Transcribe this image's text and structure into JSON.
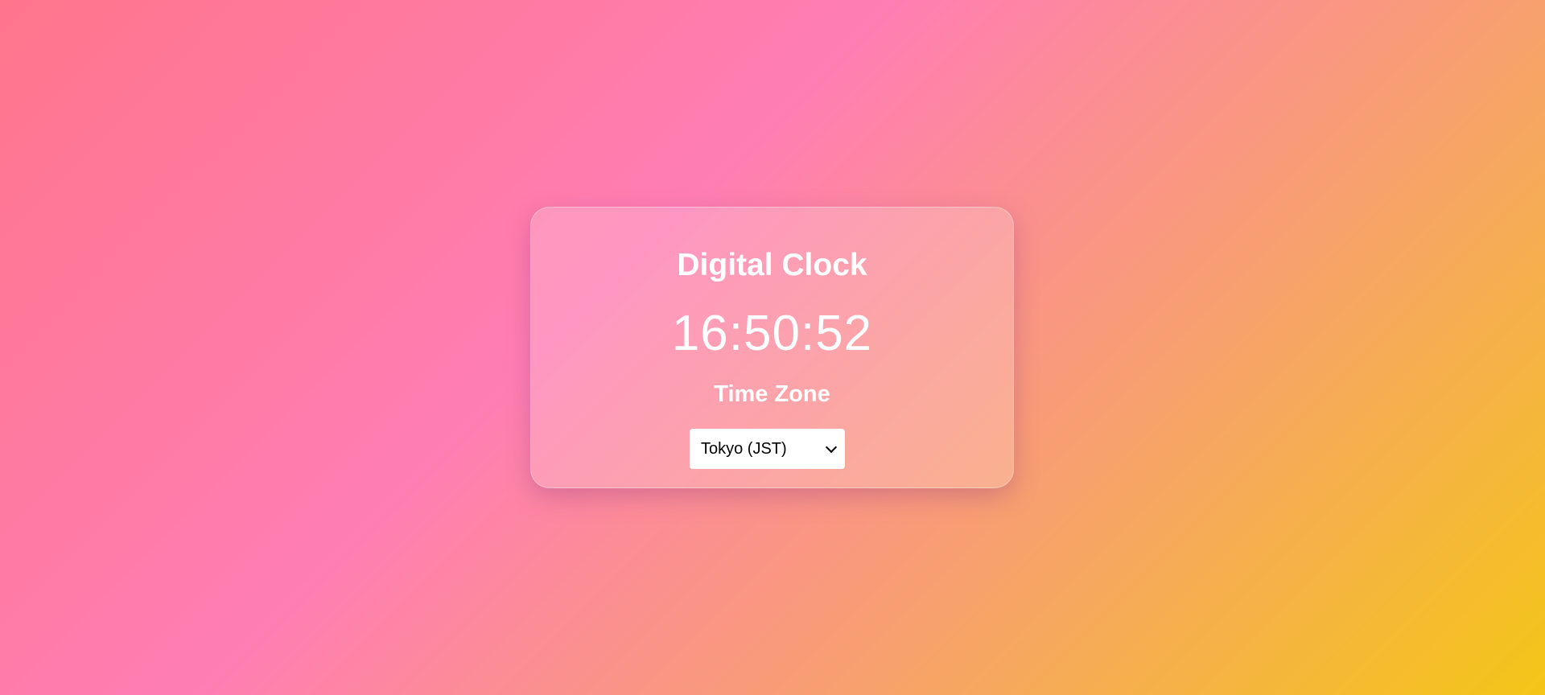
{
  "clock": {
    "title": "Digital Clock",
    "time": "16:50:52",
    "timezone_label": "Time Zone",
    "timezone_selected": "Tokyo (JST)"
  },
  "colors": {
    "bg_start": "#ff758c",
    "bg_mid": "#ff7eb3",
    "bg_end": "#f4c617",
    "text": "#ffffff"
  }
}
